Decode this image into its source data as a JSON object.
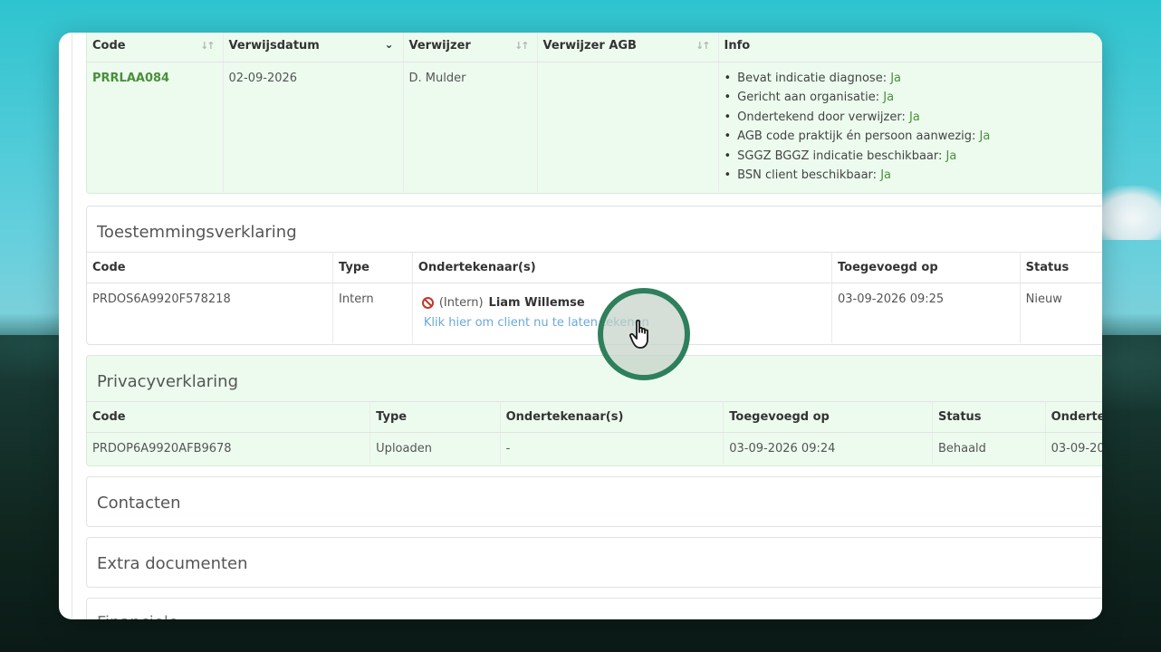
{
  "referral": {
    "columns": [
      "Code",
      "Verwijsdatum",
      "Verwijzer",
      "Verwijzer AGB",
      "Info"
    ],
    "row": {
      "code": "PRRLAA084",
      "date": "02-09-2026",
      "referrer": "D. Mulder",
      "agb": "",
      "info": [
        {
          "label": "Bevat indicatie diagnose:",
          "value": "Ja"
        },
        {
          "label": "Gericht aan organisatie:",
          "value": "Ja"
        },
        {
          "label": "Ondertekend door verwijzer:",
          "value": "Ja"
        },
        {
          "label": "AGB code praktijk én persoon aanwezig:",
          "value": "Ja"
        },
        {
          "label": "SGGZ BGGZ indicatie beschikbaar:",
          "value": "Ja"
        },
        {
          "label": "BSN client beschikbaar:",
          "value": "Ja"
        }
      ]
    }
  },
  "consent": {
    "title": "Toestemmingsverklaring",
    "columns": [
      "Code",
      "Type",
      "Ondertekenaar(s)",
      "Toegevoegd op",
      "Status"
    ],
    "row": {
      "code": "PRDOS6A9920F578218",
      "type": "Intern",
      "signer_prefix": "(Intern)",
      "signer_name": "Liam Willemse",
      "sign_link": "Klik hier om client nu te laten tekenen",
      "added": "03-09-2026 09:25",
      "status": "Nieuw"
    }
  },
  "privacy": {
    "title": "Privacyverklaring",
    "columns": [
      "Code",
      "Type",
      "Ondertekenaar(s)",
      "Toegevoegd op",
      "Status",
      "Onderte"
    ],
    "row": {
      "code": "PRDOP6A9920AFB9678",
      "type": "Uploaden",
      "signers": "-",
      "added": "03-09-2026 09:24",
      "status": "Behaald",
      "signed": "03-09-20"
    }
  },
  "contacts": {
    "title": "Contacten"
  },
  "extra_docs": {
    "title": "Extra documenten"
  },
  "next_section": {
    "title": "Financiele"
  },
  "colors": {
    "accent_green": "#4a8f3b",
    "link_blue": "#6aa8d8",
    "cursor_ring": "#2e7f5c"
  },
  "icons": [
    "sort-icon",
    "chevron-down-icon",
    "ban-icon",
    "hand-pointer-icon"
  ]
}
